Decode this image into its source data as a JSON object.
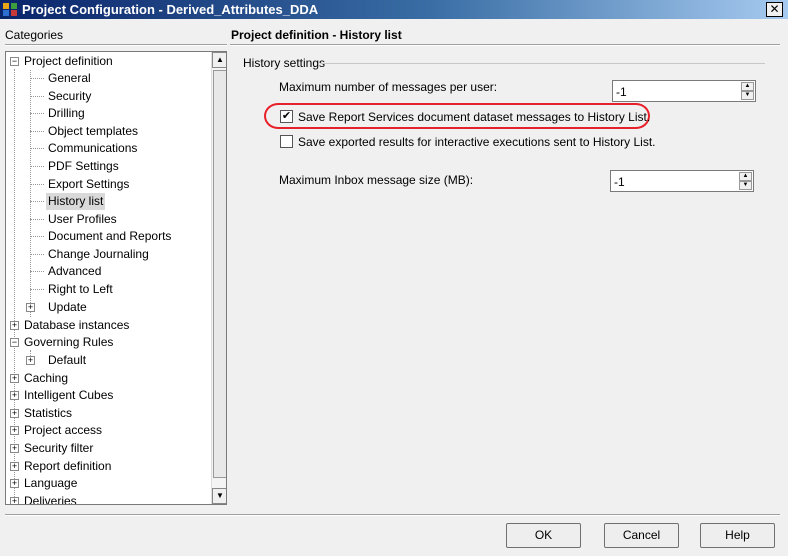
{
  "window": {
    "title": "Project Configuration - Derived_Attributes_DDA",
    "close_glyph": "✕"
  },
  "categories_label": "Categories",
  "page_title": "Project definition - History list",
  "tree": {
    "root": "Project definition",
    "children": [
      "General",
      "Security",
      "Drilling",
      "Object templates",
      "Communications",
      "PDF Settings",
      "Export Settings",
      "History list",
      "User Profiles",
      "Document and Reports",
      "Change Journaling",
      "Advanced",
      "Right to Left",
      "Update"
    ],
    "selected": "History list",
    "top_level": [
      "Database instances",
      "Governing Rules",
      "Default",
      "Caching",
      "Intelligent Cubes",
      "Statistics",
      "Project access",
      "Security filter",
      "Report definition",
      "Language",
      "Deliveries"
    ]
  },
  "history_settings": {
    "group_label": "History settings",
    "max_messages_label": "Maximum number of messages per user:",
    "max_messages_value": "-1",
    "save_dataset_label": "Save Report Services document dataset messages to History List.",
    "save_dataset_checked": true,
    "save_exported_label": "Save exported results for interactive executions sent to History List.",
    "save_exported_checked": false,
    "max_inbox_label": "Maximum Inbox message size (MB):",
    "max_inbox_value": "-1",
    "check_glyph": "✔"
  },
  "buttons": {
    "ok": "OK",
    "cancel": "Cancel",
    "help": "Help"
  },
  "colors": {
    "highlight": "#e8202a",
    "title_bar": "#0a246a"
  }
}
